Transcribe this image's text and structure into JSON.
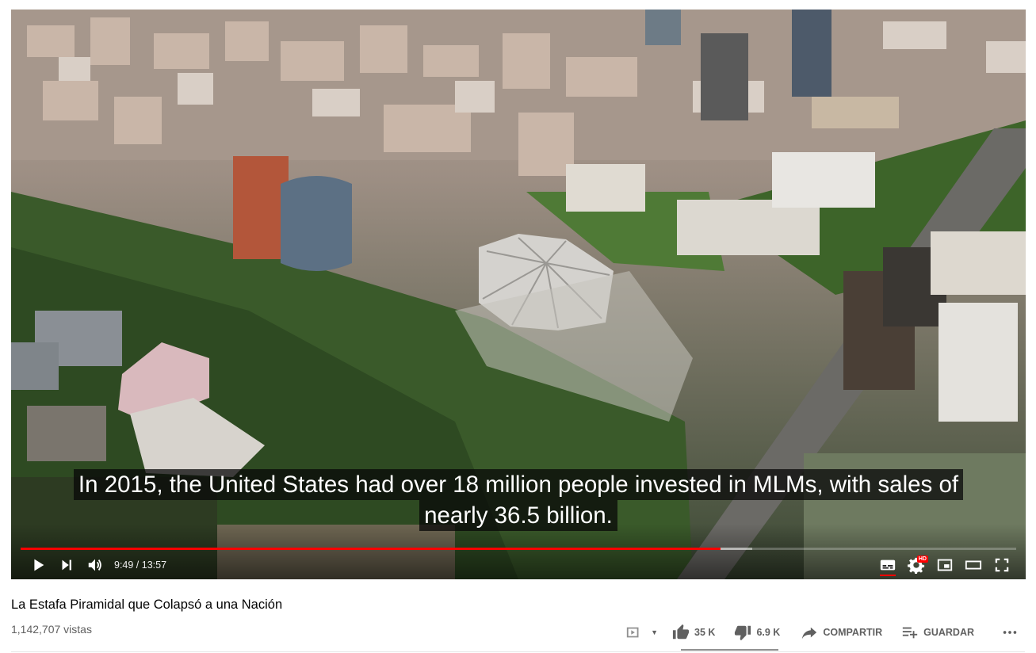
{
  "player": {
    "caption_line1": "In 2015, the United States had over 18 million people invested in MLMs, with sales of",
    "caption_line2": "nearly 36.5 billion.",
    "time_display": "9:49 / 13:57",
    "progress_fraction": 0.703,
    "buffered_fraction": 0.735,
    "hd_badge": "HD",
    "icons": [
      "play-icon",
      "next-icon",
      "volume-icon",
      "subtitles-icon",
      "settings-icon",
      "miniplayer-icon",
      "theater-icon",
      "fullscreen-icon"
    ]
  },
  "video": {
    "title": "La Estafa Piramidal que Colapsó a una Nación",
    "views": "1,142,707 vistas",
    "like_count": "35 K",
    "dislike_count": "6.9 K",
    "share_label": "COMPARTIR",
    "save_label": "GUARDAR",
    "like_fraction": 0.835
  },
  "colors": {
    "progress": "#ff0000",
    "text_secondary": "#606060"
  }
}
